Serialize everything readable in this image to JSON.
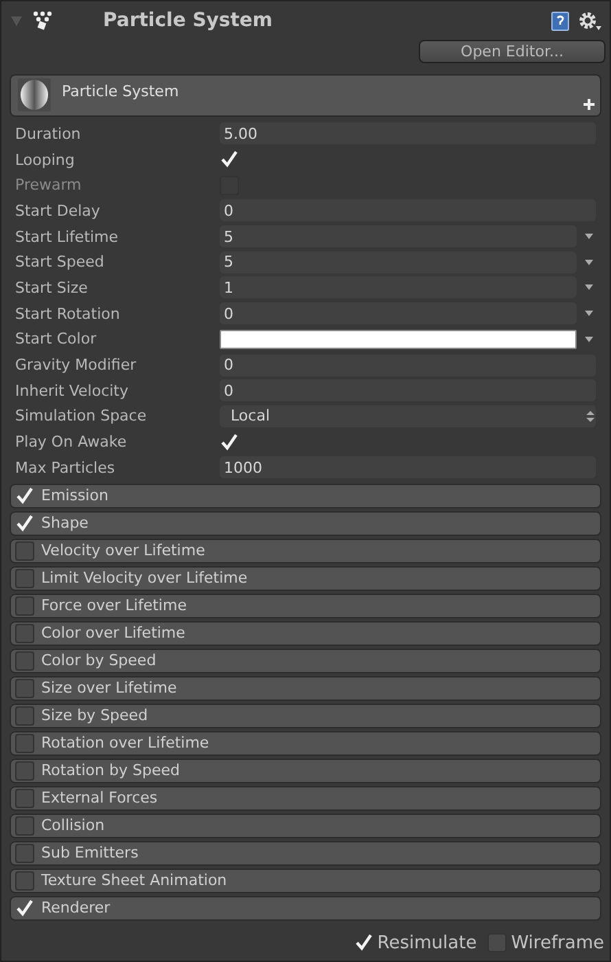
{
  "header": {
    "title": "Particle System",
    "expanded": true
  },
  "open_editor": "Open Editor...",
  "panel": {
    "title": "Particle System"
  },
  "properties": [
    {
      "label": "Duration",
      "kind": "text",
      "value": "5.00",
      "disabled": false
    },
    {
      "label": "Looping",
      "kind": "checkbox",
      "checked": true,
      "disabled": false
    },
    {
      "label": "Prewarm",
      "kind": "checkbox",
      "checked": false,
      "disabled": true
    },
    {
      "label": "Start Delay",
      "kind": "text",
      "value": "0",
      "disabled": false
    },
    {
      "label": "Start Lifetime",
      "kind": "curve",
      "value": "5",
      "disabled": false
    },
    {
      "label": "Start Speed",
      "kind": "curve",
      "value": "5",
      "disabled": false
    },
    {
      "label": "Start Size",
      "kind": "curve",
      "value": "1",
      "disabled": false
    },
    {
      "label": "Start Rotation",
      "kind": "curve",
      "value": "0",
      "disabled": false
    },
    {
      "label": "Start Color",
      "kind": "color",
      "color": "#ffffff",
      "disabled": false
    },
    {
      "label": "Gravity Modifier",
      "kind": "text",
      "value": "0",
      "disabled": false
    },
    {
      "label": "Inherit Velocity",
      "kind": "text",
      "value": "0",
      "disabled": false
    },
    {
      "label": "Simulation Space",
      "kind": "enum",
      "value": "Local",
      "disabled": false
    },
    {
      "label": "Play On Awake",
      "kind": "checkbox",
      "checked": true,
      "disabled": false
    },
    {
      "label": "Max Particles",
      "kind": "text",
      "value": "1000",
      "disabled": false
    }
  ],
  "modules": [
    {
      "label": "Emission",
      "checked": true
    },
    {
      "label": "Shape",
      "checked": true
    },
    {
      "label": "Velocity over Lifetime",
      "checked": false
    },
    {
      "label": "Limit Velocity over Lifetime",
      "checked": false
    },
    {
      "label": "Force over Lifetime",
      "checked": false
    },
    {
      "label": "Color over Lifetime",
      "checked": false
    },
    {
      "label": "Color by Speed",
      "checked": false
    },
    {
      "label": "Size over Lifetime",
      "checked": false
    },
    {
      "label": "Size by Speed",
      "checked": false
    },
    {
      "label": "Rotation over Lifetime",
      "checked": false
    },
    {
      "label": "Rotation by Speed",
      "checked": false
    },
    {
      "label": "External Forces",
      "checked": false
    },
    {
      "label": "Collision",
      "checked": false
    },
    {
      "label": "Sub Emitters",
      "checked": false
    },
    {
      "label": "Texture Sheet Animation",
      "checked": false
    },
    {
      "label": "Renderer",
      "checked": true
    }
  ],
  "footer": [
    {
      "label": "Resimulate",
      "checked": true
    },
    {
      "label": "Wireframe",
      "checked": false
    }
  ]
}
